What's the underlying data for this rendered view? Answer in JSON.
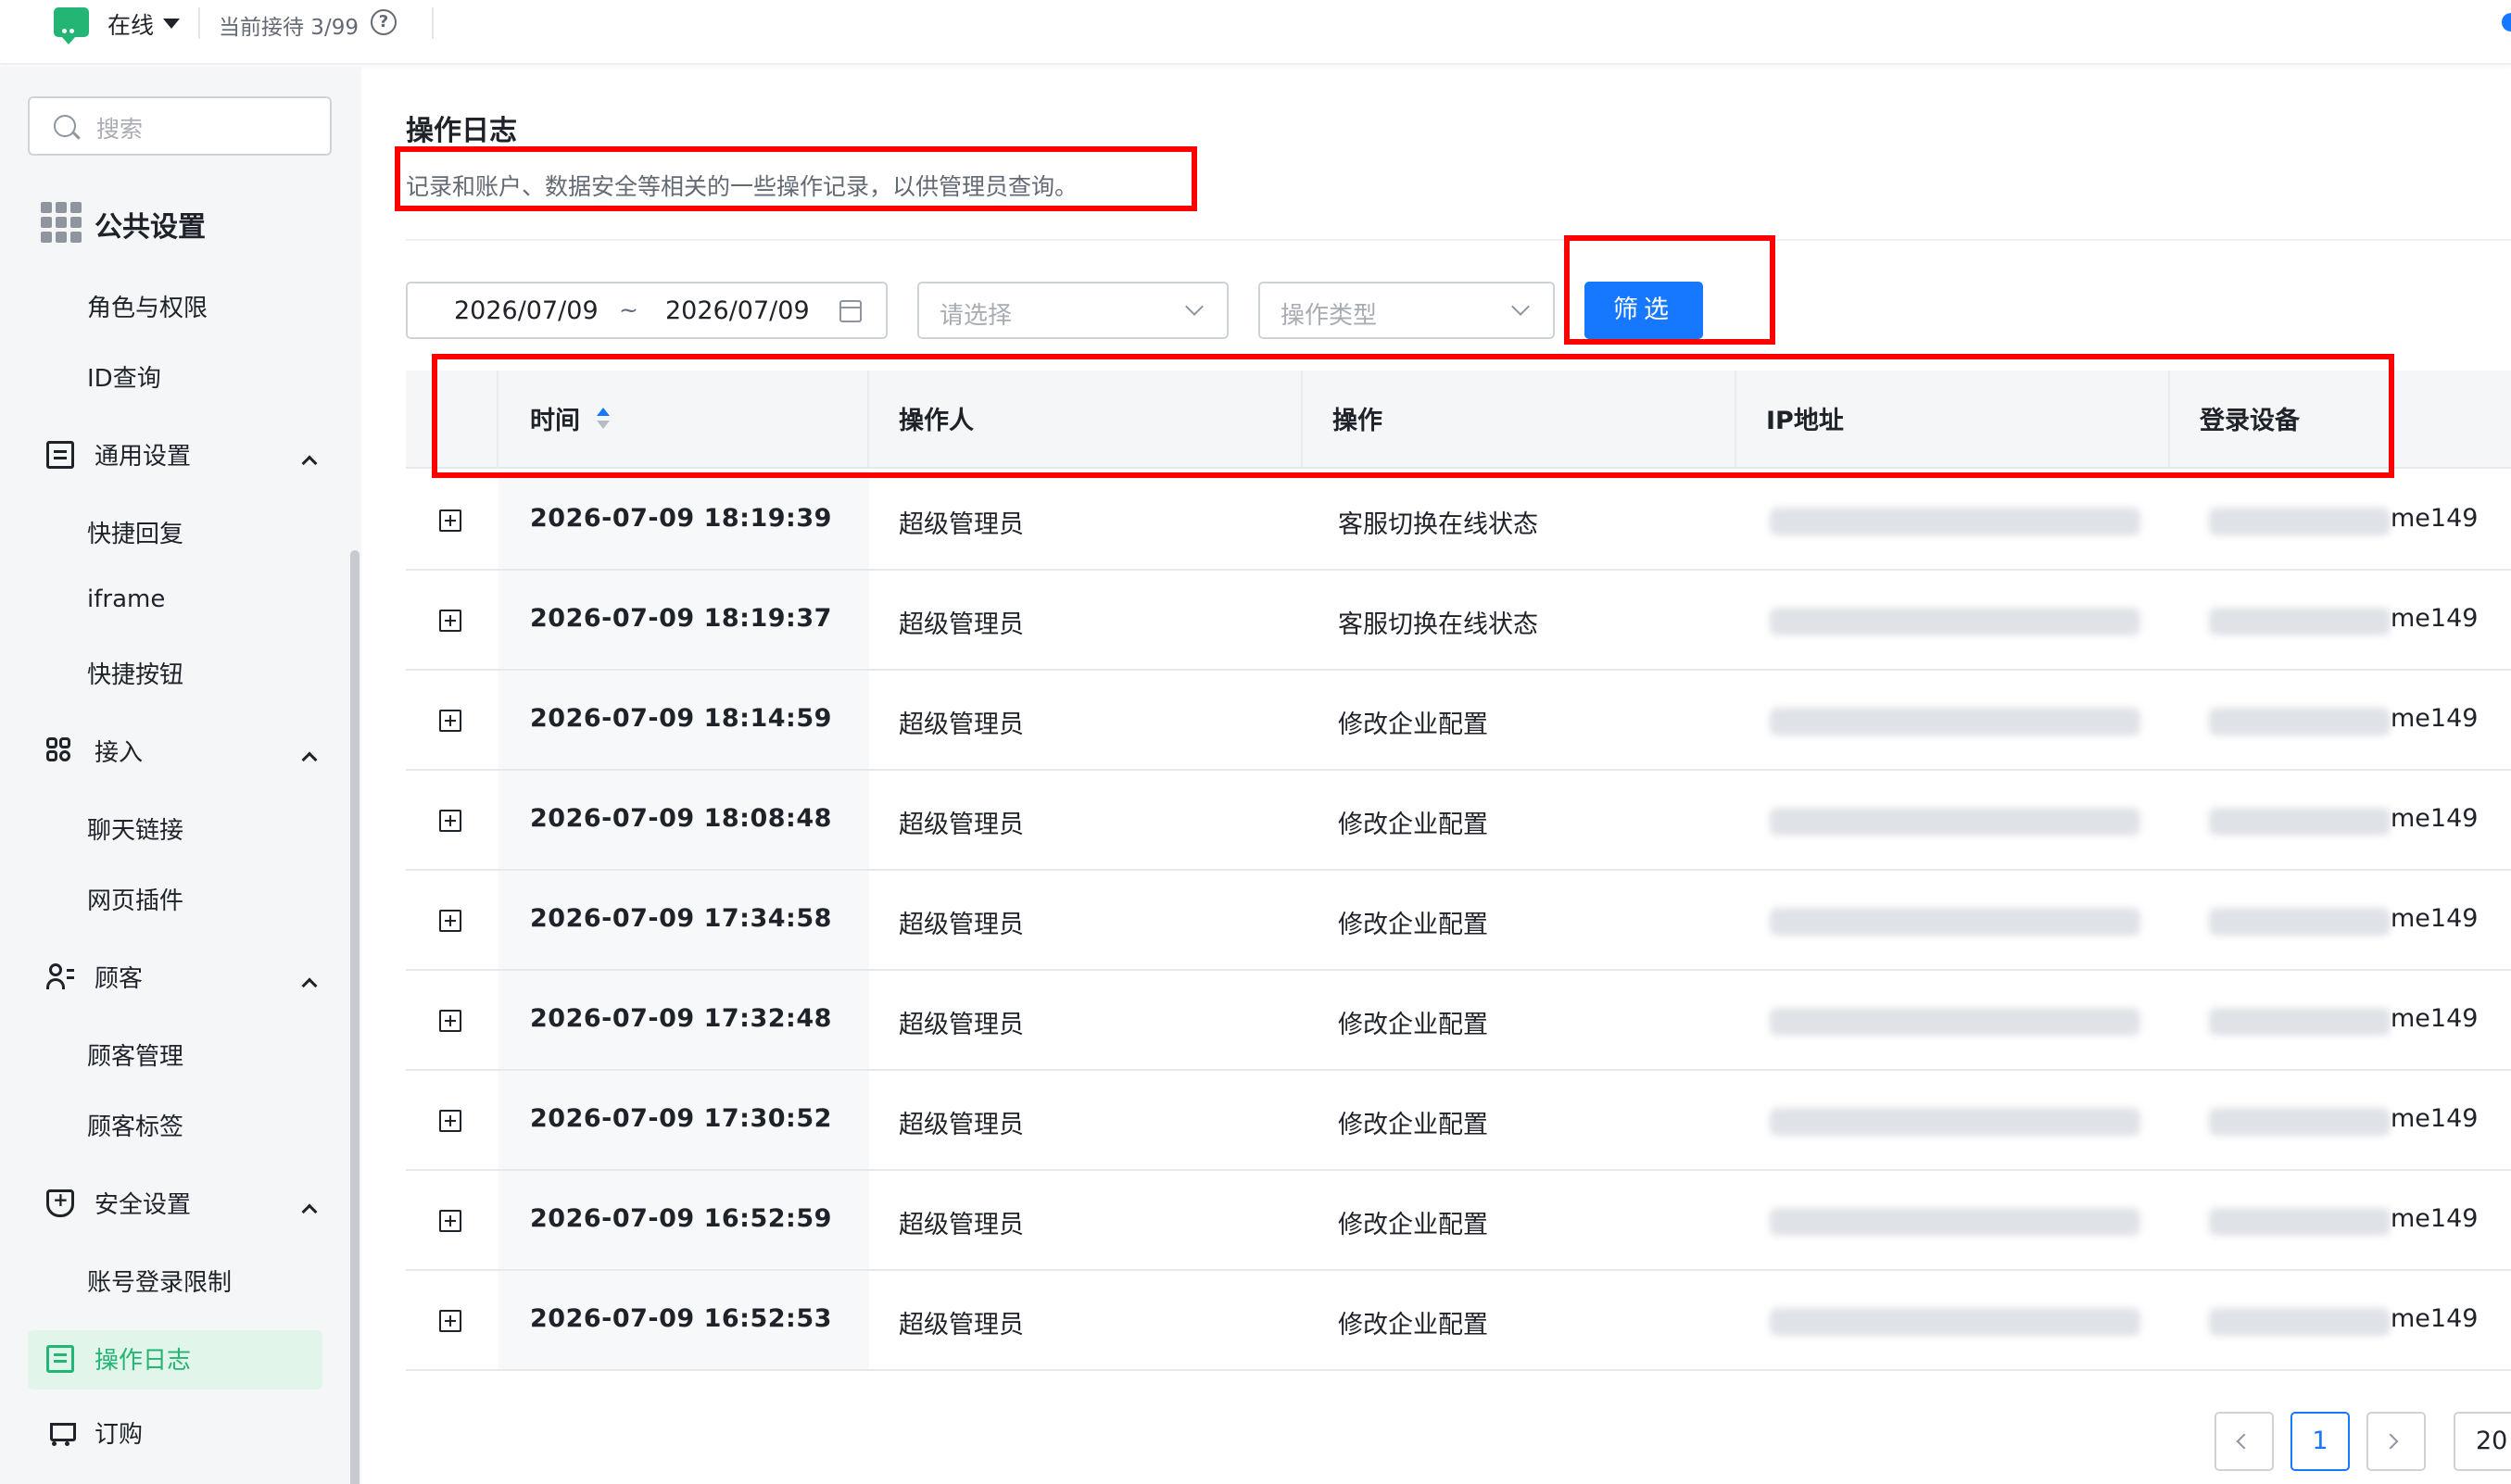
{
  "topbar": {
    "status": "在线",
    "reception": "当前接待 3/99",
    "help_icon": "question-circle-icon",
    "chat_icon": "chat-bubble-icon"
  },
  "sidebar": {
    "search_placeholder": "搜索",
    "section_title": "公共设置",
    "items": [
      {
        "label": "角色与权限",
        "type": "item"
      },
      {
        "label": "ID查询",
        "type": "item"
      },
      {
        "label": "通用设置",
        "type": "group",
        "icon": "document-icon"
      },
      {
        "label": "快捷回复",
        "type": "item"
      },
      {
        "label": "iframe",
        "type": "item"
      },
      {
        "label": "快捷按钮",
        "type": "item"
      },
      {
        "label": "接入",
        "type": "group",
        "icon": "link-icon"
      },
      {
        "label": "聊天链接",
        "type": "item"
      },
      {
        "label": "网页插件",
        "type": "item"
      },
      {
        "label": "顾客",
        "type": "group",
        "icon": "user-list-icon"
      },
      {
        "label": "顾客管理",
        "type": "item"
      },
      {
        "label": "顾客标签",
        "type": "item"
      },
      {
        "label": "安全设置",
        "type": "group",
        "icon": "shield-icon"
      },
      {
        "label": "账号登录限制",
        "type": "item"
      },
      {
        "label": "操作日志",
        "type": "active",
        "icon": "log-icon"
      },
      {
        "label": "订购",
        "type": "group",
        "icon": "cart-icon"
      }
    ]
  },
  "main": {
    "title": "操作日志",
    "description": "记录和账户、数据安全等相关的一些操作记录，以供管理员查询。",
    "filters": {
      "date_start": "2026/07/09",
      "date_sep": "~",
      "date_end": "2026/07/09",
      "select1_placeholder": "请选择",
      "select2_placeholder": "操作类型",
      "filter_button": "筛选"
    },
    "table": {
      "columns": [
        "时间",
        "操作人",
        "操作",
        "IP地址",
        "登录设备"
      ],
      "rows": [
        {
          "time": "2026-07-09 18:19:39",
          "operator": "超级管理员",
          "action": "客服切换在线状态",
          "device_suffix": "me149"
        },
        {
          "time": "2026-07-09 18:19:37",
          "operator": "超级管理员",
          "action": "客服切换在线状态",
          "device_suffix": "me149"
        },
        {
          "time": "2026-07-09 18:14:59",
          "operator": "超级管理员",
          "action": "修改企业配置",
          "device_suffix": "me149"
        },
        {
          "time": "2026-07-09 18:08:48",
          "operator": "超级管理员",
          "action": "修改企业配置",
          "device_suffix": "me149"
        },
        {
          "time": "2026-07-09 17:34:58",
          "operator": "超级管理员",
          "action": "修改企业配置",
          "device_suffix": "me149"
        },
        {
          "time": "2026-07-09 17:32:48",
          "operator": "超级管理员",
          "action": "修改企业配置",
          "device_suffix": "me149"
        },
        {
          "time": "2026-07-09 17:30:52",
          "operator": "超级管理员",
          "action": "修改企业配置",
          "device_suffix": "me149"
        },
        {
          "time": "2026-07-09 16:52:59",
          "operator": "超级管理员",
          "action": "修改企业配置",
          "device_suffix": "me149"
        },
        {
          "time": "2026-07-09 16:52:53",
          "operator": "超级管理员",
          "action": "修改企业配置",
          "device_suffix": "me149"
        }
      ]
    },
    "pagination": {
      "current_page": "1",
      "page_size": "20"
    }
  }
}
